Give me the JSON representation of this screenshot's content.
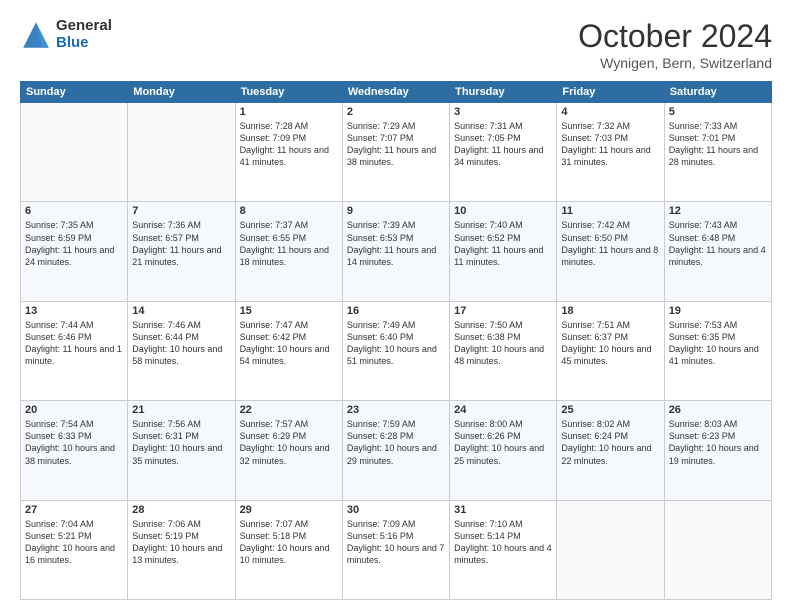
{
  "logo": {
    "general": "General",
    "blue": "Blue"
  },
  "title": "October 2024",
  "location": "Wynigen, Bern, Switzerland",
  "days_of_week": [
    "Sunday",
    "Monday",
    "Tuesday",
    "Wednesday",
    "Thursday",
    "Friday",
    "Saturday"
  ],
  "weeks": [
    [
      {
        "day": "",
        "sunrise": "",
        "sunset": "",
        "daylight": ""
      },
      {
        "day": "",
        "sunrise": "",
        "sunset": "",
        "daylight": ""
      },
      {
        "day": "1",
        "sunrise": "Sunrise: 7:28 AM",
        "sunset": "Sunset: 7:09 PM",
        "daylight": "Daylight: 11 hours and 41 minutes."
      },
      {
        "day": "2",
        "sunrise": "Sunrise: 7:29 AM",
        "sunset": "Sunset: 7:07 PM",
        "daylight": "Daylight: 11 hours and 38 minutes."
      },
      {
        "day": "3",
        "sunrise": "Sunrise: 7:31 AM",
        "sunset": "Sunset: 7:05 PM",
        "daylight": "Daylight: 11 hours and 34 minutes."
      },
      {
        "day": "4",
        "sunrise": "Sunrise: 7:32 AM",
        "sunset": "Sunset: 7:03 PM",
        "daylight": "Daylight: 11 hours and 31 minutes."
      },
      {
        "day": "5",
        "sunrise": "Sunrise: 7:33 AM",
        "sunset": "Sunset: 7:01 PM",
        "daylight": "Daylight: 11 hours and 28 minutes."
      }
    ],
    [
      {
        "day": "6",
        "sunrise": "Sunrise: 7:35 AM",
        "sunset": "Sunset: 6:59 PM",
        "daylight": "Daylight: 11 hours and 24 minutes."
      },
      {
        "day": "7",
        "sunrise": "Sunrise: 7:36 AM",
        "sunset": "Sunset: 6:57 PM",
        "daylight": "Daylight: 11 hours and 21 minutes."
      },
      {
        "day": "8",
        "sunrise": "Sunrise: 7:37 AM",
        "sunset": "Sunset: 6:55 PM",
        "daylight": "Daylight: 11 hours and 18 minutes."
      },
      {
        "day": "9",
        "sunrise": "Sunrise: 7:39 AM",
        "sunset": "Sunset: 6:53 PM",
        "daylight": "Daylight: 11 hours and 14 minutes."
      },
      {
        "day": "10",
        "sunrise": "Sunrise: 7:40 AM",
        "sunset": "Sunset: 6:52 PM",
        "daylight": "Daylight: 11 hours and 11 minutes."
      },
      {
        "day": "11",
        "sunrise": "Sunrise: 7:42 AM",
        "sunset": "Sunset: 6:50 PM",
        "daylight": "Daylight: 11 hours and 8 minutes."
      },
      {
        "day": "12",
        "sunrise": "Sunrise: 7:43 AM",
        "sunset": "Sunset: 6:48 PM",
        "daylight": "Daylight: 11 hours and 4 minutes."
      }
    ],
    [
      {
        "day": "13",
        "sunrise": "Sunrise: 7:44 AM",
        "sunset": "Sunset: 6:46 PM",
        "daylight": "Daylight: 11 hours and 1 minute."
      },
      {
        "day": "14",
        "sunrise": "Sunrise: 7:46 AM",
        "sunset": "Sunset: 6:44 PM",
        "daylight": "Daylight: 10 hours and 58 minutes."
      },
      {
        "day": "15",
        "sunrise": "Sunrise: 7:47 AM",
        "sunset": "Sunset: 6:42 PM",
        "daylight": "Daylight: 10 hours and 54 minutes."
      },
      {
        "day": "16",
        "sunrise": "Sunrise: 7:49 AM",
        "sunset": "Sunset: 6:40 PM",
        "daylight": "Daylight: 10 hours and 51 minutes."
      },
      {
        "day": "17",
        "sunrise": "Sunrise: 7:50 AM",
        "sunset": "Sunset: 6:38 PM",
        "daylight": "Daylight: 10 hours and 48 minutes."
      },
      {
        "day": "18",
        "sunrise": "Sunrise: 7:51 AM",
        "sunset": "Sunset: 6:37 PM",
        "daylight": "Daylight: 10 hours and 45 minutes."
      },
      {
        "day": "19",
        "sunrise": "Sunrise: 7:53 AM",
        "sunset": "Sunset: 6:35 PM",
        "daylight": "Daylight: 10 hours and 41 minutes."
      }
    ],
    [
      {
        "day": "20",
        "sunrise": "Sunrise: 7:54 AM",
        "sunset": "Sunset: 6:33 PM",
        "daylight": "Daylight: 10 hours and 38 minutes."
      },
      {
        "day": "21",
        "sunrise": "Sunrise: 7:56 AM",
        "sunset": "Sunset: 6:31 PM",
        "daylight": "Daylight: 10 hours and 35 minutes."
      },
      {
        "day": "22",
        "sunrise": "Sunrise: 7:57 AM",
        "sunset": "Sunset: 6:29 PM",
        "daylight": "Daylight: 10 hours and 32 minutes."
      },
      {
        "day": "23",
        "sunrise": "Sunrise: 7:59 AM",
        "sunset": "Sunset: 6:28 PM",
        "daylight": "Daylight: 10 hours and 29 minutes."
      },
      {
        "day": "24",
        "sunrise": "Sunrise: 8:00 AM",
        "sunset": "Sunset: 6:26 PM",
        "daylight": "Daylight: 10 hours and 25 minutes."
      },
      {
        "day": "25",
        "sunrise": "Sunrise: 8:02 AM",
        "sunset": "Sunset: 6:24 PM",
        "daylight": "Daylight: 10 hours and 22 minutes."
      },
      {
        "day": "26",
        "sunrise": "Sunrise: 8:03 AM",
        "sunset": "Sunset: 6:23 PM",
        "daylight": "Daylight: 10 hours and 19 minutes."
      }
    ],
    [
      {
        "day": "27",
        "sunrise": "Sunrise: 7:04 AM",
        "sunset": "Sunset: 5:21 PM",
        "daylight": "Daylight: 10 hours and 16 minutes."
      },
      {
        "day": "28",
        "sunrise": "Sunrise: 7:06 AM",
        "sunset": "Sunset: 5:19 PM",
        "daylight": "Daylight: 10 hours and 13 minutes."
      },
      {
        "day": "29",
        "sunrise": "Sunrise: 7:07 AM",
        "sunset": "Sunset: 5:18 PM",
        "daylight": "Daylight: 10 hours and 10 minutes."
      },
      {
        "day": "30",
        "sunrise": "Sunrise: 7:09 AM",
        "sunset": "Sunset: 5:16 PM",
        "daylight": "Daylight: 10 hours and 7 minutes."
      },
      {
        "day": "31",
        "sunrise": "Sunrise: 7:10 AM",
        "sunset": "Sunset: 5:14 PM",
        "daylight": "Daylight: 10 hours and 4 minutes."
      },
      {
        "day": "",
        "sunrise": "",
        "sunset": "",
        "daylight": ""
      },
      {
        "day": "",
        "sunrise": "",
        "sunset": "",
        "daylight": ""
      }
    ]
  ]
}
